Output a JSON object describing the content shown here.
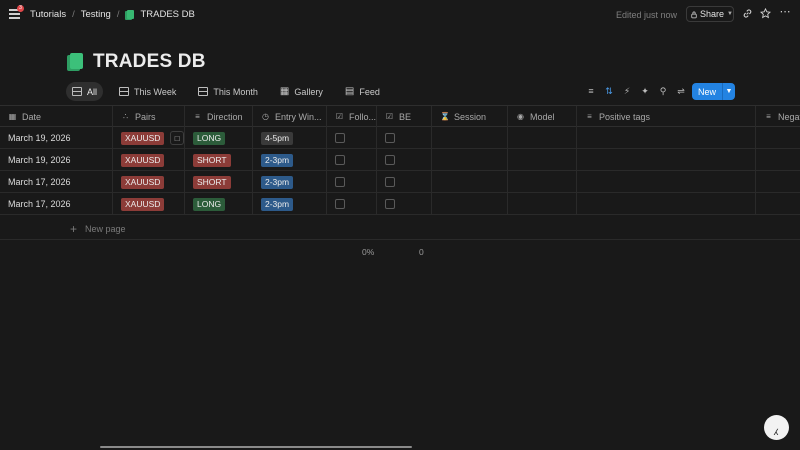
{
  "topbar": {
    "menu_badge": "3",
    "breadcrumbs": [
      "Tutorials",
      "Testing",
      "TRADES DB"
    ],
    "edited": "Edited just now",
    "share_label": "Share"
  },
  "page": {
    "title": "TRADES DB"
  },
  "views": [
    "All",
    "This Week",
    "This Month",
    "Gallery",
    "Feed"
  ],
  "toolbar": {
    "new_label": "New",
    "icons": [
      "filter-icon",
      "sort-icon",
      "lightning-icon",
      "wand-icon",
      "search-icon",
      "settings-sliders-icon"
    ]
  },
  "columns": [
    "Date",
    "Pairs",
    "Direction",
    "Entry Win...",
    "Follo...",
    "BE",
    "Session",
    "Model",
    "Positive tags",
    "Negat"
  ],
  "rows": [
    {
      "date": "March 19, 2026",
      "pair": "XAUUSD",
      "direction": "LONG",
      "entry": "4-5pm"
    },
    {
      "date": "March 19, 2026",
      "pair": "XAUUSD",
      "direction": "SHORT",
      "entry": "2-3pm"
    },
    {
      "date": "March 17, 2026",
      "pair": "XAUUSD",
      "direction": "SHORT",
      "entry": "2-3pm"
    },
    {
      "date": "March 17, 2026",
      "pair": "XAUUSD",
      "direction": "LONG",
      "entry": "2-3pm"
    }
  ],
  "new_page_label": "New page",
  "calculations": {
    "followed": "0%",
    "be": "0"
  },
  "colors": {
    "accent": "#2383e2",
    "tag_red": "#8c3c38",
    "tag_green": "#2c5c3a",
    "tag_blue": "#2d5a8a",
    "tag_gray": "#3a3a3a"
  }
}
